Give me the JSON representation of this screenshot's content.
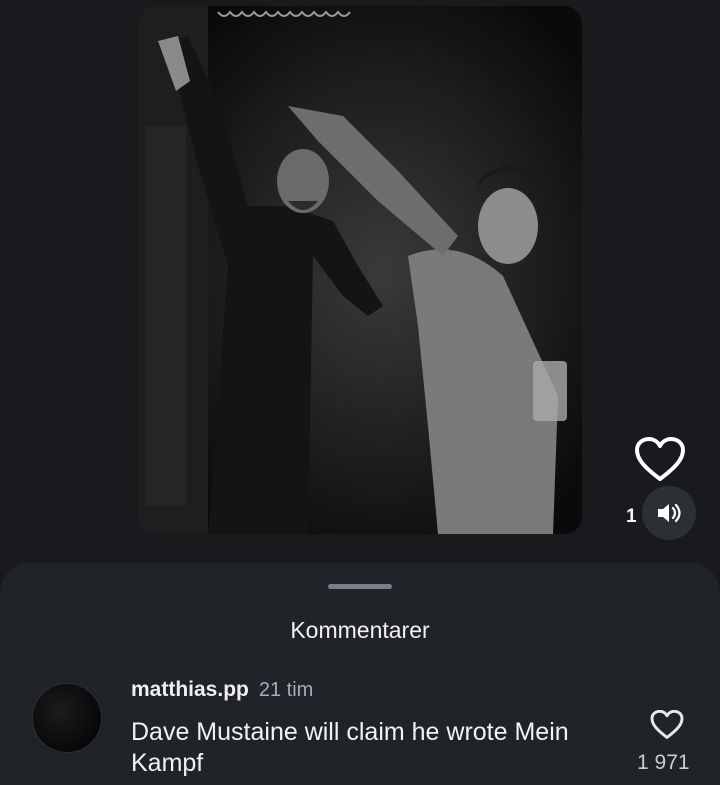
{
  "post": {
    "like_count": "1",
    "image_alt": "black and white photo of two men in a dark room"
  },
  "comments_sheet": {
    "title": "Kommentarer",
    "comment": {
      "username": "matthias.pp",
      "time": "21 tim",
      "text": "Dave Mustaine will claim he wrote Mein Kampf",
      "like_count": "1 971"
    }
  },
  "icons": {
    "like": "heart-outline-icon",
    "sound": "speaker-icon",
    "comment_like": "heart-outline-icon"
  },
  "colors": {
    "background": "#181a1d",
    "sheet": "#202327",
    "text": "#f2f2f2",
    "muted": "#a9adb3"
  }
}
